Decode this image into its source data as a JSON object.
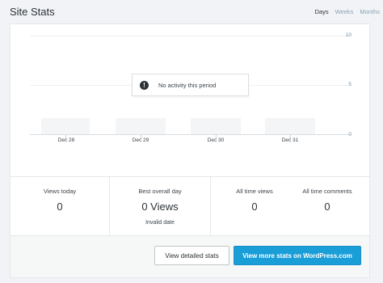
{
  "header": {
    "title": "Site Stats",
    "periods": [
      "Days",
      "Weeks",
      "Months"
    ],
    "active_period": "Days"
  },
  "chart_data": {
    "type": "bar",
    "categories": [
      "Dec 28",
      "Dec 29",
      "Dec 30",
      "Dec 31"
    ],
    "values": [
      0,
      0,
      0,
      0
    ],
    "ylim": [
      0,
      10
    ],
    "yticks": [
      "10",
      "5",
      "0"
    ],
    "title": "",
    "xlabel": "",
    "ylabel": ""
  },
  "notice": {
    "icon": "exclamation-circle-icon",
    "text": "No activity this period"
  },
  "stats": {
    "views_today": {
      "label": "Views today",
      "value": "0"
    },
    "best_day": {
      "label": "Best overall day",
      "value": "0 Views",
      "sub": "Invalid date"
    },
    "all_time_views": {
      "label": "All time views",
      "value": "0"
    },
    "all_time_comments": {
      "label": "All time comments",
      "value": "0"
    }
  },
  "buttons": {
    "detailed": "View detailed stats",
    "more": "View more stats on WordPress.com"
  },
  "colors": {
    "primary": "#1a9ed8",
    "background": "#f1f3f6"
  }
}
